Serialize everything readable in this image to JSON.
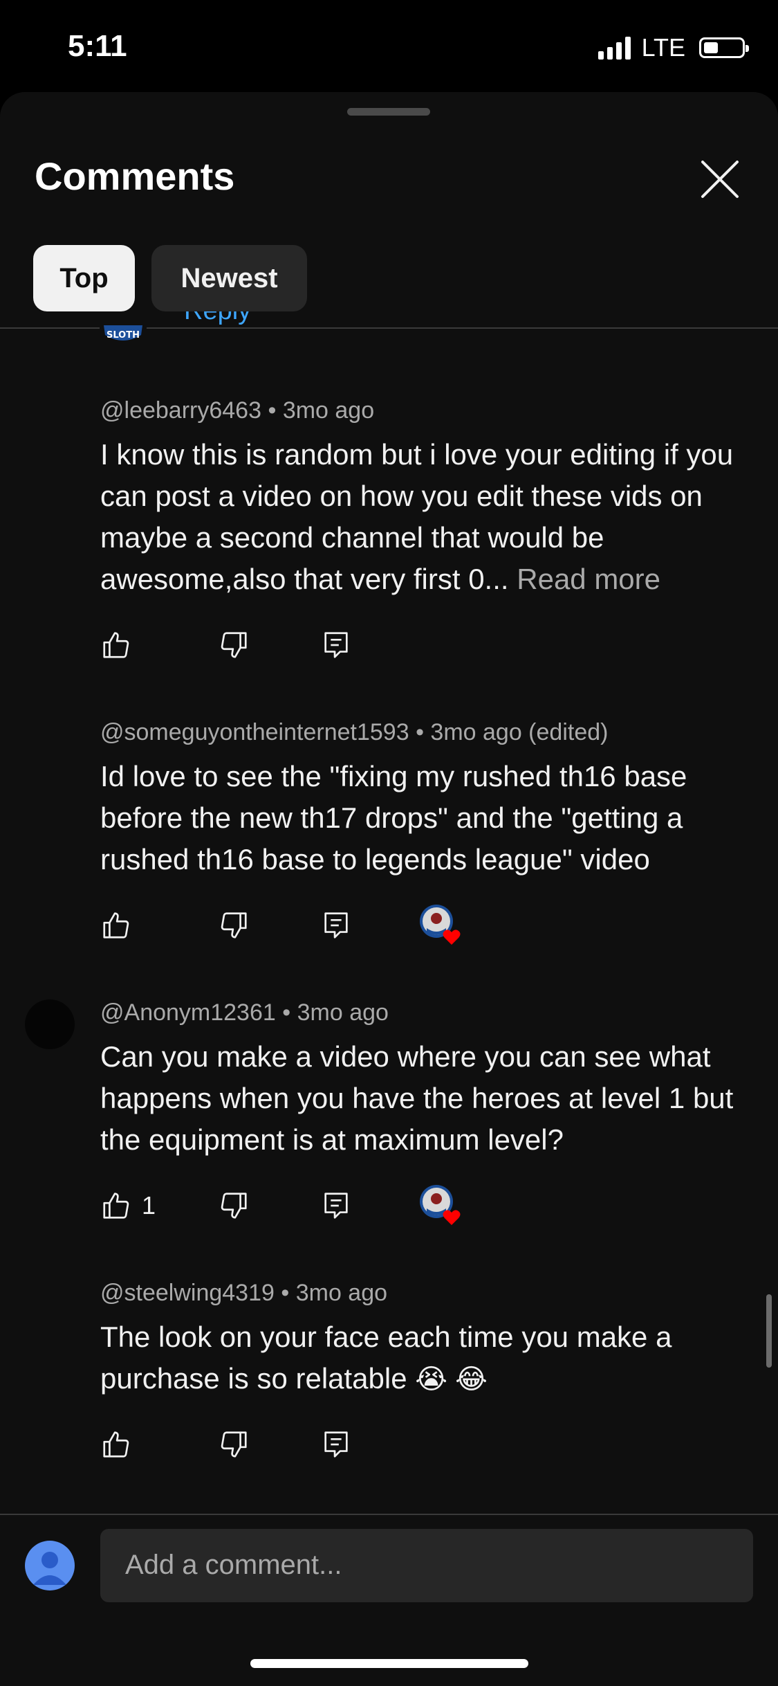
{
  "status_bar": {
    "time": "5:11",
    "network": "LTE"
  },
  "header": {
    "title": "Comments"
  },
  "tabs": [
    {
      "label": "Top",
      "selected": true
    },
    {
      "label": "Newest",
      "selected": false
    }
  ],
  "partial": {
    "reply_text": "Reply",
    "logo_text": "SLOTH"
  },
  "comments": [
    {
      "author": "@leebarry6463",
      "age": "3mo ago",
      "text": "I know this is random but i love your editing if you can post a video on how you edit these vids on maybe a second channel that would be awesome,also that very first 0...",
      "read_more": "Read more",
      "likes": "",
      "creator_heart": false
    },
    {
      "author": "@someguyontheinternet1593",
      "age": "3mo ago (edited)",
      "text": "Id love to see the \"fixing my rushed th16 base before the new th17 drops\" and the \"getting a rushed th16 base to legends league\" video",
      "likes": "",
      "creator_heart": true
    },
    {
      "author": "@Anonym12361",
      "age": "3mo ago",
      "text": "Can you make a video where you can see what happens when you have the heroes at level 1 but the equipment is at maximum level?",
      "likes": "1",
      "creator_heart": true
    },
    {
      "author": "@steelwing4319",
      "age": "3mo ago",
      "text": "The look on your face each time you make a purchase is so relatable",
      "emojis": "😭 😂",
      "likes": "",
      "creator_heart": false
    }
  ],
  "composer": {
    "placeholder": "Add a comment..."
  },
  "meta_separator": "•",
  "colors": {
    "background": "#0f0f0f",
    "link": "#3ea6ff",
    "heart": "#ff0000",
    "secondary_text": "#aaaaaa"
  }
}
